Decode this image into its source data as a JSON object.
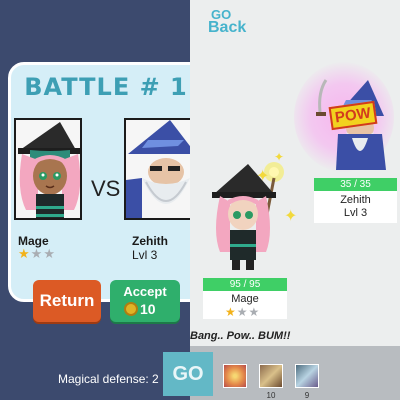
{
  "left_panel": {
    "title": "BATTLE # 1",
    "vs_label": "VS",
    "player": {
      "name": "Mage",
      "stars_filled": 1,
      "stars_total": 3
    },
    "opponent": {
      "name": "Zehith",
      "level": "Lvl 3"
    },
    "buttons": {
      "return_label": "Return",
      "accept_label": "Accept",
      "accept_cost": "10"
    },
    "stat_text": "Magical defense: 2"
  },
  "right_panel": {
    "go_label": "GO",
    "back_label": "Back",
    "opponent": {
      "hp": "35 / 35",
      "name": "Zehith",
      "level": "Lvl 3",
      "effect_text": "POW"
    },
    "player": {
      "hp": "95 / 95",
      "name": "Mage",
      "stars_filled": 1,
      "stars_total": 3
    },
    "battle_log": "Bang.. Pow.. BUM!!",
    "skills": [
      {
        "icon": "fire-burst-icon",
        "count": ""
      },
      {
        "icon": "staff-strike-icon",
        "count": "10"
      },
      {
        "icon": "frost-wave-icon",
        "count": "9"
      }
    ],
    "go_button_label": "GO"
  },
  "colors": {
    "left_bg": "#3c4a6e",
    "card_bg": "#d5eef7",
    "title": "#3d9fb4",
    "return_button": "#dc5a25",
    "accept_button": "#2faf6c",
    "hp_bar": "#3fcf66",
    "go_button": "#63b8c6",
    "link": "#46b3cc"
  }
}
